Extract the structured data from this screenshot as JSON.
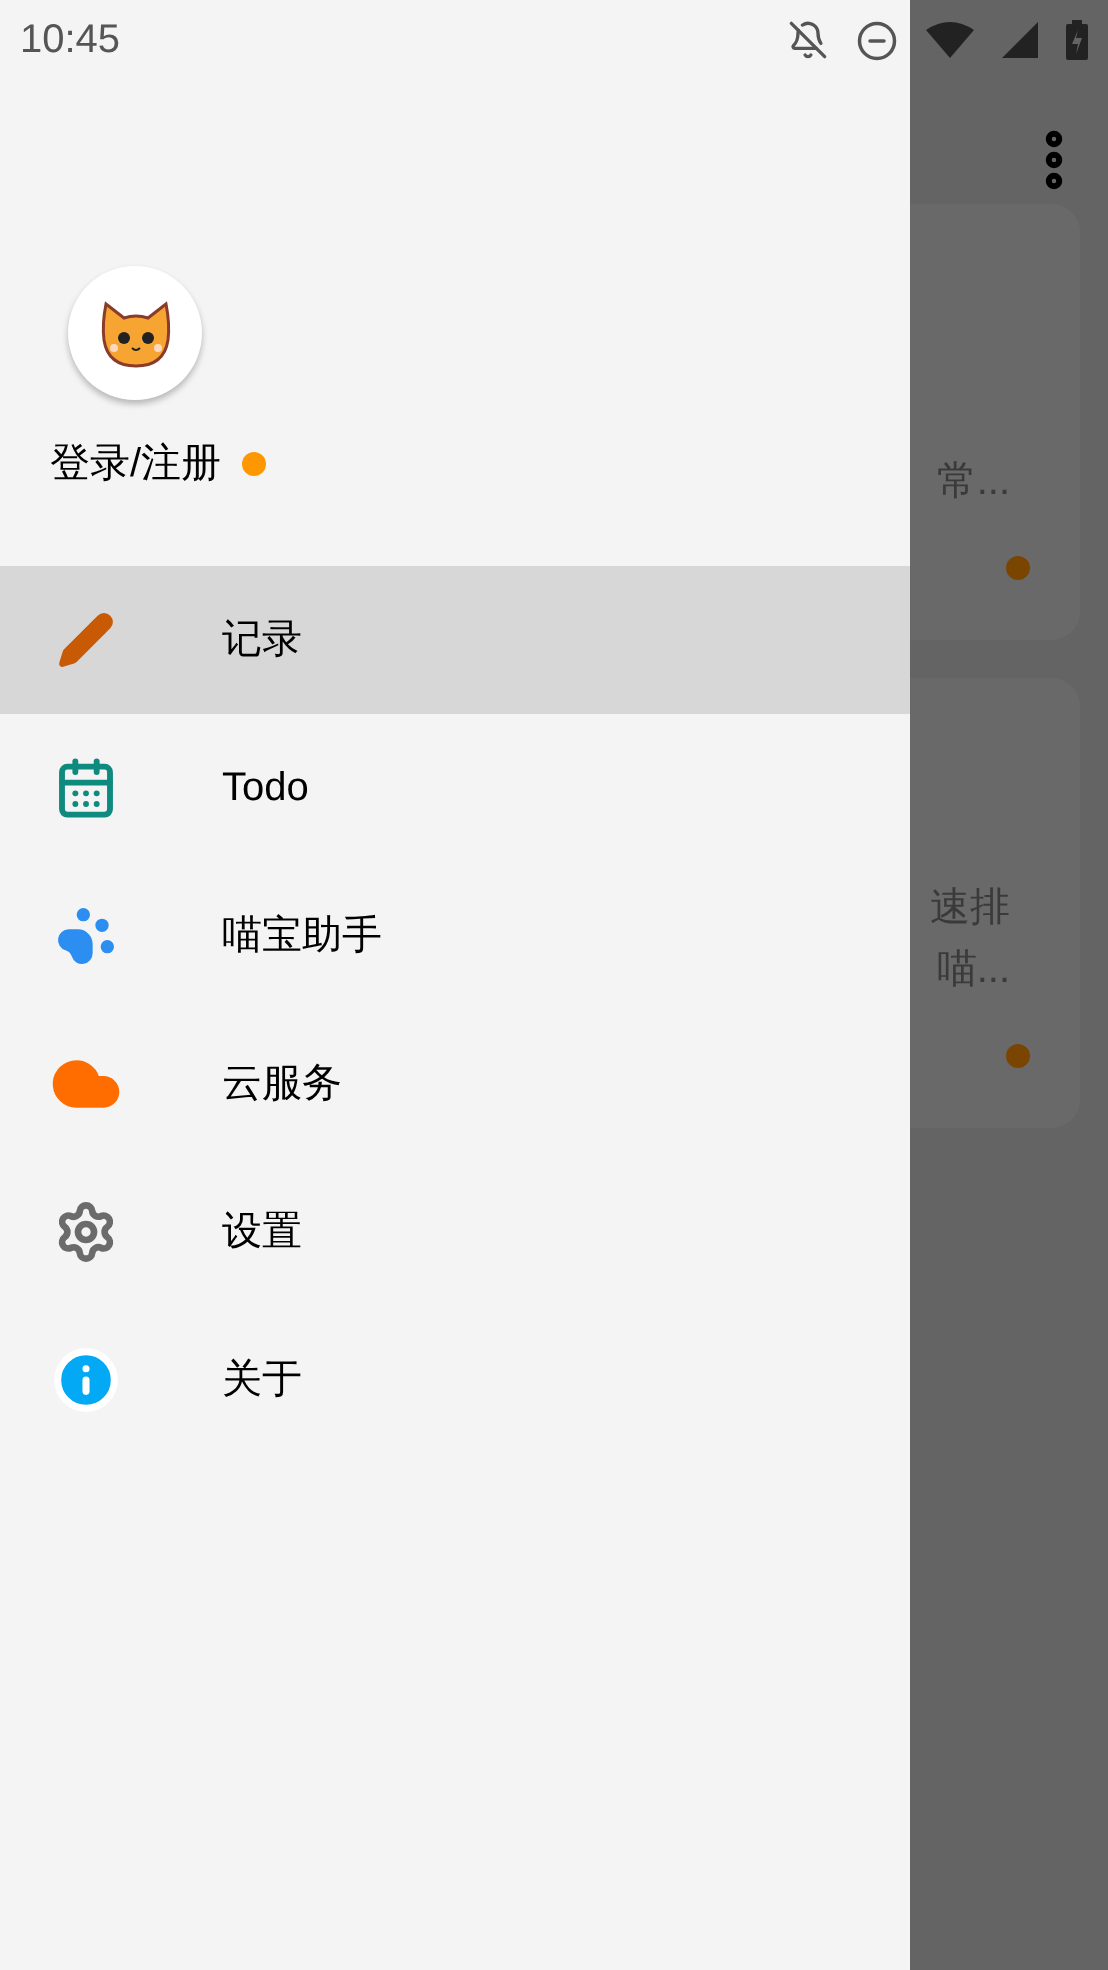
{
  "status_bar": {
    "time": "10:45"
  },
  "drawer": {
    "account": {
      "label": "登录/注册"
    },
    "items": [
      {
        "label": "记录",
        "selected": true
      },
      {
        "label": "Todo",
        "selected": false
      },
      {
        "label": "喵宝助手",
        "selected": false
      },
      {
        "label": "云服务",
        "selected": false
      },
      {
        "label": "设置",
        "selected": false
      },
      {
        "label": "关于",
        "selected": false
      }
    ]
  },
  "background_cards": [
    {
      "lines": [
        "常..."
      ]
    },
    {
      "lines": [
        "速排",
        "喵..."
      ]
    }
  ]
}
